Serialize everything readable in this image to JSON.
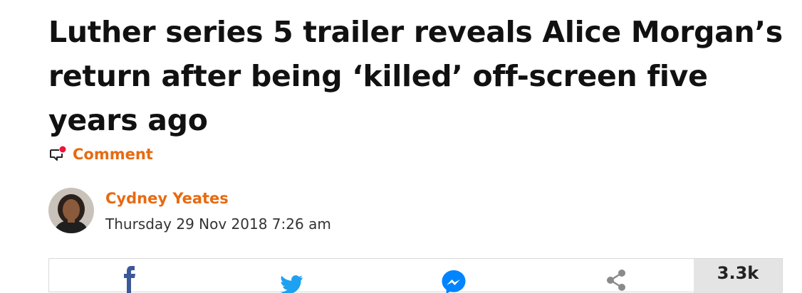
{
  "article": {
    "headline": "Luther series 5 trailer reveals Alice Morgan’s return after being ‘killed’ off-screen five years ago",
    "comment_label": "Comment"
  },
  "author": {
    "name": "Cydney Yeates",
    "date": "Thursday 29 Nov 2018 7:26 am"
  },
  "share": {
    "buttons": [
      {
        "icon": "facebook-icon"
      },
      {
        "icon": "twitter-icon"
      },
      {
        "icon": "messenger-icon"
      },
      {
        "icon": "share-icon"
      }
    ],
    "count": "3.3k"
  },
  "colors": {
    "accent": "#e86a10",
    "headline": "#111111",
    "notification_dot": "#e8163c",
    "facebook": "#3b5998",
    "twitter": "#1da1f2",
    "messenger": "#0084ff",
    "share_icon": "#8a8a8a",
    "count_bg": "#e4e4e4"
  }
}
